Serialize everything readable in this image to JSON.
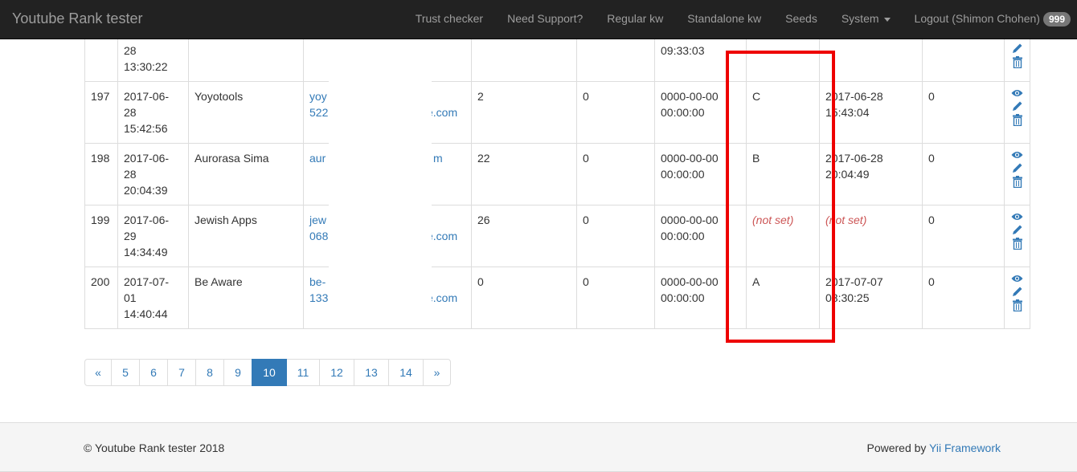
{
  "navbar": {
    "brand": "Youtube Rank tester",
    "items": [
      {
        "label": "Trust checker"
      },
      {
        "label": "Need Support?"
      },
      {
        "label": "Regular kw"
      },
      {
        "label": "Standalone kw"
      },
      {
        "label": "Seeds"
      },
      {
        "label": "System"
      },
      {
        "label": "Logout (Shimon Chohen)"
      }
    ],
    "badge": "999"
  },
  "table": {
    "partial_row": {
      "created_l1": "28",
      "created_l2": "13:30:22",
      "updated_l2": "09:33:03"
    },
    "rows": [
      {
        "id": "197",
        "created_l1": "2017-06-",
        "created_l2": "28",
        "created_l3": "15:42:56",
        "name": "Yoyotools",
        "link_l1": "yoy",
        "link_l2": "522",
        "link_tail": "e.com",
        "c1": "2",
        "c2": "0",
        "updated_l1": "0000-00-00",
        "updated_l2": "00:00:00",
        "grade": "C",
        "checked_l1": "2017-06-28",
        "checked_l2": "15:43:04",
        "c3": "0"
      },
      {
        "id": "198",
        "created_l1": "2017-06-",
        "created_l2": "28",
        "created_l3": "20:04:39",
        "name": "Aurorasa Sima",
        "link_l1": "aur",
        "link_l2": "",
        "link_tail": "m",
        "c1": "22",
        "c2": "0",
        "updated_l1": "0000-00-00",
        "updated_l2": "00:00:00",
        "grade": "B",
        "checked_l1": "2017-06-28",
        "checked_l2": "20:04:49",
        "c3": "0"
      },
      {
        "id": "199",
        "created_l1": "2017-06-",
        "created_l2": "29",
        "created_l3": "14:34:49",
        "name": "Jewish Apps",
        "link_l1": "jew",
        "link_l2": "068",
        "link_tail": "e.com",
        "c1": "26",
        "c2": "0",
        "updated_l1": "0000-00-00",
        "updated_l2": "00:00:00",
        "grade": "(not set)",
        "checked_l1": "(not set)",
        "checked_l2": "",
        "c3": "0"
      },
      {
        "id": "200",
        "created_l1": "2017-07-",
        "created_l2": "01",
        "created_l3": "14:40:44",
        "name": "Be Aware",
        "link_l1": "be-",
        "link_l2": "133",
        "link_tail": "e.com",
        "c1": "0",
        "c2": "0",
        "updated_l1": "0000-00-00",
        "updated_l2": "00:00:00",
        "grade": "A",
        "checked_l1": "2017-07-07",
        "checked_l2": "08:30:25",
        "c3": "0"
      }
    ]
  },
  "pagination": {
    "prev": "«",
    "pages": [
      "5",
      "6",
      "7",
      "8",
      "9",
      "10",
      "11",
      "12",
      "13",
      "14"
    ],
    "active": "10",
    "next": "»"
  },
  "footer": {
    "copyright": "© Youtube Rank tester 2018",
    "powered_prefix": "Powered by ",
    "powered_link": "Yii Framework"
  },
  "colors": {
    "navbar_bg": "#222222",
    "link": "#337ab7",
    "highlight": "#ee0000",
    "not_set": "#cc5555"
  }
}
